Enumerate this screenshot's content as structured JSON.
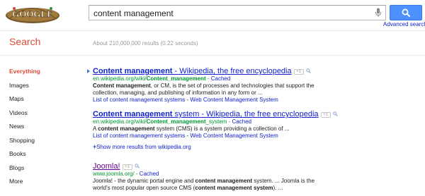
{
  "header": {
    "logo_text": "GOOGLE",
    "query": "content management",
    "search_button_label": "Search",
    "advanced_search": "Advanced search"
  },
  "subheader": {
    "search_label": "Search",
    "stats": "About 210,000,000 results (0.22 seconds)"
  },
  "sidebar": {
    "items": [
      {
        "label": "Everything",
        "active": true
      },
      {
        "label": "Images"
      },
      {
        "label": "Maps"
      },
      {
        "label": "Videos"
      },
      {
        "label": "News"
      },
      {
        "label": "Shopping"
      },
      {
        "label": "Books"
      },
      {
        "label": "Blogs"
      },
      {
        "label": "More"
      }
    ]
  },
  "results": [
    {
      "title_bold": "Content management",
      "title_rest": " - Wikipedia, the free encyclopedia",
      "url_prefix": "en.wikipedia.org/wiki/",
      "url_bold": "Content_management",
      "url_suffix": "",
      "cached": "Cached",
      "snippet1_bold": "Content management",
      "snippet1_rest": ", or CM, is the set of processes and technologies that support the",
      "snippet2": "collection, managing, and publishing of information in any form or ...",
      "sitelink1": "List of content management systems",
      "sitelink2": "Web Content Management System"
    },
    {
      "title_bold": "Content management",
      "title_rest": " system - Wikipedia, the free encyclopedia",
      "url_prefix": "en.wikipedia.org/wiki/",
      "url_bold": "Content_management",
      "url_suffix": "_system",
      "cached": "Cached",
      "snippet1_pre": "A ",
      "snippet1_bold": "content management",
      "snippet1_rest": " system (CMS) is a system providing a collection of ...",
      "sitelink1": "List of content management systems",
      "sitelink2": "Web Content Management System"
    },
    {
      "title": "Joomla!",
      "url": "www.joomla.org/",
      "cached": "Cached",
      "snippet1_pre": "Joomla! - the dynamic portal engine and ",
      "snippet1_bold": "content management",
      "snippet1_rest": " system. ... Joomla is the",
      "snippet2_pre": "world's most popular open source CMS (",
      "snippet2_bold": "content management system",
      "snippet2_rest": "). ..."
    }
  ],
  "more_results": "Show more results from wikipedia.org",
  "plus_one": "+1",
  "sitelink_separator": " - ",
  "url_separator": " - ",
  "colors": {
    "link": "#1122cc",
    "visited": "#660099",
    "url": "#009933",
    "accent": "#dd4b39",
    "button": "#4d90fe"
  }
}
